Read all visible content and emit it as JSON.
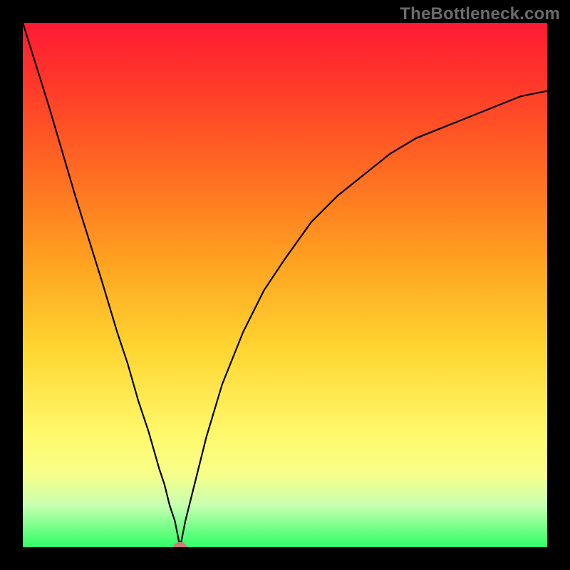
{
  "watermark": "TheBottleneck.com",
  "chart_data": {
    "type": "line",
    "title": "",
    "xlabel": "",
    "ylabel": "",
    "xlim": [
      0,
      1
    ],
    "ylim": [
      0,
      1
    ],
    "grid": false,
    "series": [
      {
        "name": "curve",
        "color": "#000000",
        "x": [
          0.0,
          0.05,
          0.1,
          0.15,
          0.18,
          0.2,
          0.22,
          0.24,
          0.26,
          0.27,
          0.28,
          0.29,
          0.295,
          0.3,
          0.305,
          0.31,
          0.32,
          0.33,
          0.35,
          0.38,
          0.42,
          0.46,
          0.5,
          0.55,
          0.6,
          0.65,
          0.7,
          0.75,
          0.8,
          0.85,
          0.9,
          0.95,
          1.0
        ],
        "y": [
          1.0,
          0.84,
          0.67,
          0.51,
          0.41,
          0.35,
          0.28,
          0.22,
          0.15,
          0.12,
          0.08,
          0.05,
          0.025,
          0.0,
          0.025,
          0.05,
          0.09,
          0.13,
          0.21,
          0.31,
          0.41,
          0.49,
          0.55,
          0.62,
          0.67,
          0.71,
          0.75,
          0.78,
          0.8,
          0.82,
          0.84,
          0.86,
          0.87
        ]
      }
    ],
    "marker": {
      "x": 0.3,
      "y": 0.0,
      "rx": 0.012,
      "ry": 0.009,
      "color": "#d07a78"
    },
    "background": {
      "type": "vertical-gradient",
      "stops": [
        {
          "pos": 0.0,
          "color": "#ff1a33"
        },
        {
          "pos": 0.28,
          "color": "#ff6a22"
        },
        {
          "pos": 0.62,
          "color": "#ffd530"
        },
        {
          "pos": 0.86,
          "color": "#f8ff8a"
        },
        {
          "pos": 1.0,
          "color": "#2eff67"
        }
      ]
    }
  }
}
